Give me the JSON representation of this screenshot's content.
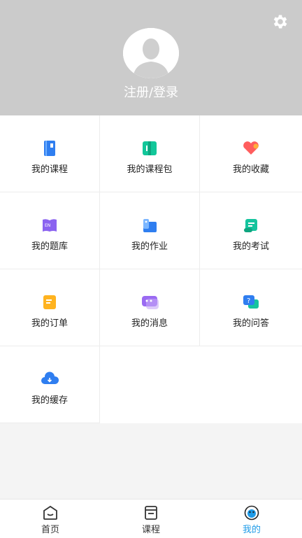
{
  "header": {
    "login_text": "注册/登录"
  },
  "menu": {
    "courses": "我的课程",
    "course_packages": "我的课程包",
    "favorites": "我的收藏",
    "question_bank": "我的题库",
    "homework": "我的作业",
    "exams": "我的考试",
    "orders": "我的订单",
    "messages": "我的消息",
    "qa": "我的问答",
    "cache": "我的缓存"
  },
  "tabbar": {
    "home": "首页",
    "courses": "课程",
    "mine": "我的",
    "active": "mine",
    "active_color": "#1e9be8"
  }
}
